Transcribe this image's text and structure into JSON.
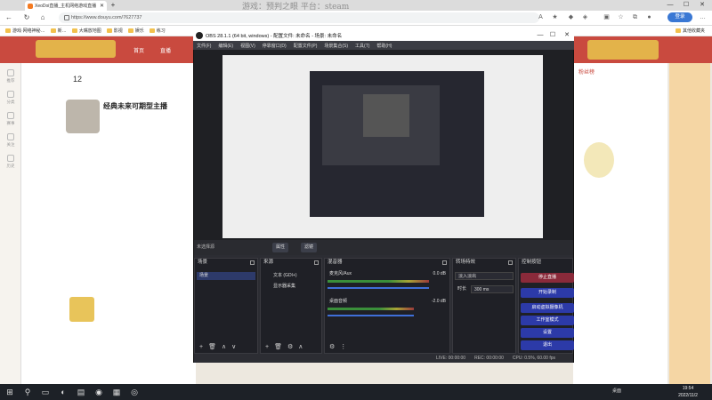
{
  "browser": {
    "tab_title": "XeoDoi直播_主机网络游戏直播",
    "url": "https://www.douyu.com/7627737",
    "login_label": "登录",
    "bookmarks": [
      "游戏·网络神秘…",
      "新…",
      "大嘴放地图",
      "影视",
      "娱乐",
      "练习"
    ],
    "ext_folder": "其他收藏夹",
    "overlay_text": "游戏：预判之眼   平台：steam"
  },
  "douyu": {
    "channel_title": "经典未来可期型主播",
    "stat_count": "12",
    "nav": [
      "首页",
      "直播"
    ],
    "left_nav": [
      "推荐",
      "分类",
      "赛事",
      "关注",
      "历史"
    ],
    "rank_label": "粉丝榜"
  },
  "obs": {
    "title": "OBS 28.1.1 (64 bit, windows) - 配置文件: 未命名 - 场景: 未命名",
    "menu": [
      "文件(F)",
      "编辑(E)",
      "视图(V)",
      "停靠窗口(D)",
      "配置文件(P)",
      "场景集合(S)",
      "工具(T)",
      "帮助(H)"
    ],
    "no_source_selected": "未选择源",
    "props_label": "属性",
    "filters_label": "滤镜",
    "scenes": {
      "title": "场景",
      "items": [
        "场景"
      ]
    },
    "sources": {
      "title": "来源",
      "items": [
        "文本 (GDI+)",
        "显示器采集"
      ]
    },
    "mixer": {
      "title": "混音器",
      "channels": [
        {
          "name": "麦克风/Aux",
          "db": "0.0 dB",
          "level": 0.92
        },
        {
          "name": "桌面音频",
          "db": "-2.0 dB",
          "level": 0.78
        }
      ]
    },
    "transitions": {
      "title": "转场特效",
      "type": "淡入淡出",
      "duration_label": "时长",
      "duration": "300 ms"
    },
    "controls": {
      "title": "控制按钮",
      "buttons": [
        "停止直播",
        "开始录制",
        "启动虚拟摄像机",
        "工作室模式",
        "设置",
        "退出"
      ]
    },
    "status": {
      "live": "LIVE: 00:00:00",
      "rec": "REC: 00:00:00",
      "cpu": "CPU: 0.5%, 60.00 fps"
    }
  },
  "taskbar": {
    "desk_label": "桌面",
    "time": "19:54",
    "date": "2022/11/2"
  }
}
